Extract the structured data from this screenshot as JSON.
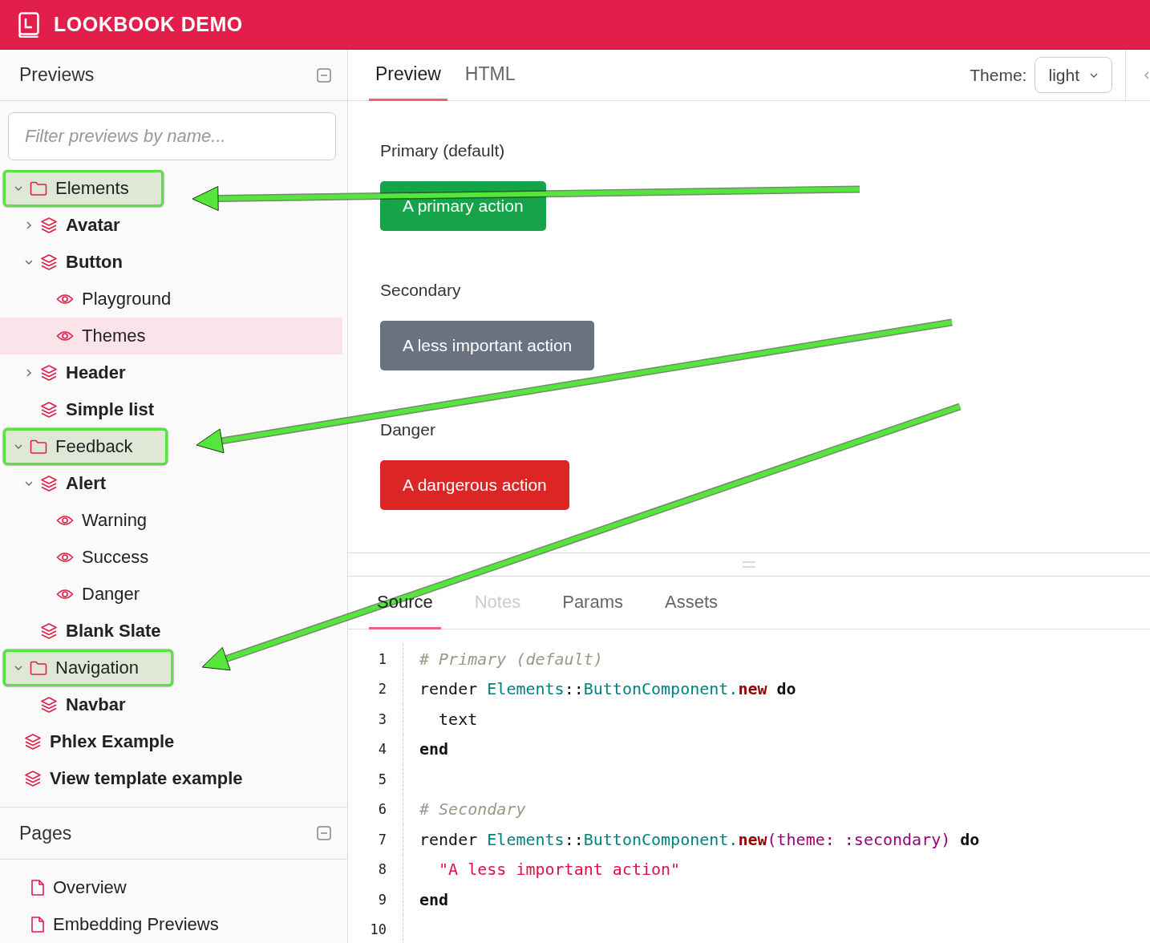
{
  "app": {
    "title": "LOOKBOOK DEMO"
  },
  "previews": {
    "title": "Previews",
    "filter": {
      "placeholder": "Filter previews by name..."
    },
    "tree": [
      {
        "label": "Elements",
        "kind": "folder",
        "expanded": true,
        "selected": false,
        "annotated": true,
        "children": [
          {
            "label": "Avatar",
            "kind": "component",
            "expanded": false,
            "selected": false,
            "annotated": false
          },
          {
            "label": "Button",
            "kind": "component",
            "expanded": true,
            "selected": false,
            "annotated": false,
            "children": [
              {
                "label": "Playground",
                "kind": "preview",
                "selected": false,
                "annotated": false
              },
              {
                "label": "Themes",
                "kind": "preview",
                "selected": true,
                "annotated": false
              }
            ]
          },
          {
            "label": "Header",
            "kind": "component",
            "expanded": false,
            "selected": false,
            "annotated": false
          },
          {
            "label": "Simple list",
            "kind": "component",
            "selected": false,
            "annotated": false
          }
        ]
      },
      {
        "label": "Feedback",
        "kind": "folder",
        "expanded": true,
        "selected": false,
        "annotated": true,
        "children": [
          {
            "label": "Alert",
            "kind": "component",
            "expanded": true,
            "selected": false,
            "annotated": false,
            "children": [
              {
                "label": "Warning",
                "kind": "preview",
                "selected": false,
                "annotated": false
              },
              {
                "label": "Success",
                "kind": "preview",
                "selected": false,
                "annotated": false
              },
              {
                "label": "Danger",
                "kind": "preview",
                "selected": false,
                "annotated": false
              }
            ]
          },
          {
            "label": "Blank Slate",
            "kind": "component",
            "selected": false,
            "annotated": false
          }
        ]
      },
      {
        "label": "Navigation",
        "kind": "folder",
        "expanded": true,
        "selected": false,
        "annotated": true,
        "children": [
          {
            "label": "Navbar",
            "kind": "component",
            "selected": false,
            "annotated": false
          }
        ]
      },
      {
        "label": "Phlex Example",
        "kind": "component",
        "selected": false,
        "annotated": false
      },
      {
        "label": "View template example",
        "kind": "component",
        "selected": false,
        "annotated": false
      }
    ]
  },
  "pages": {
    "title": "Pages",
    "items": [
      {
        "label": "Overview",
        "selected": false
      },
      {
        "label": "Embedding Previews",
        "selected": false
      }
    ]
  },
  "tabs": [
    {
      "label": "Preview",
      "selected": true
    },
    {
      "label": "HTML",
      "selected": false
    }
  ],
  "theme": {
    "label": "Theme:",
    "value": "light"
  },
  "examples": [
    {
      "title": "Primary (default)",
      "button": "A primary action",
      "color": "#16a34a"
    },
    {
      "title": "Secondary",
      "button": "A less important action",
      "color": "#6b7280"
    },
    {
      "title": "Danger",
      "button": "A dangerous action",
      "color": "#dc2626"
    }
  ],
  "inspector_tabs": [
    {
      "label": "Source",
      "selected": true,
      "disabled": false
    },
    {
      "label": "Notes",
      "selected": false,
      "disabled": true
    },
    {
      "label": "Params",
      "selected": false,
      "disabled": false
    },
    {
      "label": "Assets",
      "selected": false,
      "disabled": false
    }
  ],
  "source": [
    {
      "number": "1",
      "tokens": [
        {
          "kind": "comment",
          "text": "# Primary (default)"
        }
      ]
    },
    {
      "number": "2",
      "tokens": [
        {
          "kind": "plain",
          "text": "render "
        },
        {
          "kind": "const",
          "text": "Elements"
        },
        {
          "kind": "plain",
          "text": "::"
        },
        {
          "kind": "const",
          "text": "ButtonComponent."
        },
        {
          "kind": "method",
          "text": "new"
        },
        {
          "kind": "keyword",
          "text": " do"
        }
      ]
    },
    {
      "number": "3",
      "tokens": [
        {
          "kind": "plain",
          "text": "  text"
        }
      ]
    },
    {
      "number": "4",
      "tokens": [
        {
          "kind": "keyword",
          "text": "end"
        }
      ]
    },
    {
      "number": "5"
    },
    {
      "number": "6",
      "tokens": [
        {
          "kind": "comment",
          "text": "# Secondary"
        }
      ]
    },
    {
      "number": "7",
      "tokens": [
        {
          "kind": "plain",
          "text": "render "
        },
        {
          "kind": "const",
          "text": "Elements"
        },
        {
          "kind": "plain",
          "text": "::"
        },
        {
          "kind": "const",
          "text": "ButtonComponent."
        },
        {
          "kind": "method",
          "text": "new"
        },
        {
          "kind": "symbol",
          "text": "(theme: :secondary)"
        },
        {
          "kind": "keyword",
          "text": " do"
        }
      ]
    },
    {
      "number": "8",
      "tokens": [
        {
          "kind": "string",
          "text": "  \"A less important action\""
        }
      ]
    },
    {
      "number": "9",
      "tokens": [
        {
          "kind": "keyword",
          "text": "end"
        }
      ]
    },
    {
      "number": "10"
    }
  ]
}
